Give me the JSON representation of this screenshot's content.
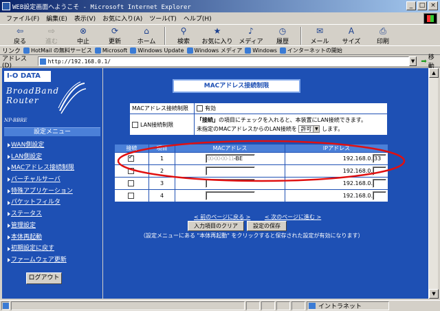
{
  "window": {
    "title": "WEB設定画面へようこそ - Microsoft Internet Explorer"
  },
  "menubar": [
    "ファイル(F)",
    "編集(E)",
    "表示(V)",
    "お気に入り(A)",
    "ツール(T)",
    "ヘルプ(H)"
  ],
  "toolbar": {
    "back": "戻る",
    "forward": "進む",
    "stop": "中止",
    "refresh": "更新",
    "home": "ホーム",
    "search": "検索",
    "favorites": "お気に入り",
    "media": "メディア",
    "history": "履歴",
    "mail": "メール",
    "size": "サイズ",
    "print": "印刷"
  },
  "links": {
    "label": "リンク",
    "items": [
      "HotMail の無料サービス",
      "Microsoft",
      "Windows Update",
      "Windows メディア",
      "Windows",
      "インターネットの開始"
    ]
  },
  "address": {
    "label": "アドレス(D)",
    "url": "http://192.168.0.1/",
    "go": "移動"
  },
  "left": {
    "logo": "I-O DATA",
    "brand_line1": "BroadBand",
    "brand_line2": "Router",
    "model": "NP-BBRE",
    "menu_header": "設定メニュー",
    "nav": [
      "WAN側設定",
      "LAN側設定",
      "MACアドレス接続制限",
      "バーチャルサーバ",
      "特殊アプリケーション",
      "パケットフィルタ",
      "ステータス",
      "管理設定",
      "本体再起動",
      "初期設定に戻す",
      "ファームウェア更新"
    ],
    "logout": "ログアウト"
  },
  "content": {
    "page_title": "MACアドレス接続制限",
    "row1_label": "MACアドレス接続制限",
    "row1_value": "有効",
    "row2_label": "LAN接続制限",
    "row2_line1_bold": "「接続」",
    "row2_line1_rest": "の項目にチェックを入れると、本装置にLAN接続できます。",
    "row2_line2_pre": "未指定のMACアドレスからのLAN接続を",
    "row2_select": "許可",
    "row2_line2_post": "します。",
    "table_headers": [
      "接続",
      "項目",
      "MACアドレス",
      "IPアドレス"
    ],
    "rows": [
      {
        "num": "1",
        "checked": true,
        "mac_blur": "00-00-00-11",
        "mac_tail": "-BE",
        "ip_prefix": "192.168.0.",
        "ip_last": "33"
      },
      {
        "num": "2",
        "checked": false,
        "mac_blur": "",
        "mac_tail": "",
        "ip_prefix": "192.168.0.",
        "ip_last": ""
      },
      {
        "num": "3",
        "checked": false,
        "mac_blur": "",
        "mac_tail": "",
        "ip_prefix": "192.168.0.",
        "ip_last": ""
      },
      {
        "num": "4",
        "checked": false,
        "mac_blur": "",
        "mac_tail": "",
        "ip_prefix": "192.168.0.",
        "ip_last": ""
      }
    ],
    "prev_page": "< 前のページに戻る >",
    "next_page": "< 次のページに進む >",
    "clear_button": "入力項目のクリア",
    "save_button": "設定の保存",
    "note": "（設定メニューにある \"本体再起動\" をクリックすると保存された設定が有効になります）"
  },
  "status": {
    "zone": "イントラネット"
  },
  "colors": {
    "page_bg": "#1e50b4",
    "header_cell": "#4b80d8",
    "annotation_ellipse": "#e01010"
  }
}
